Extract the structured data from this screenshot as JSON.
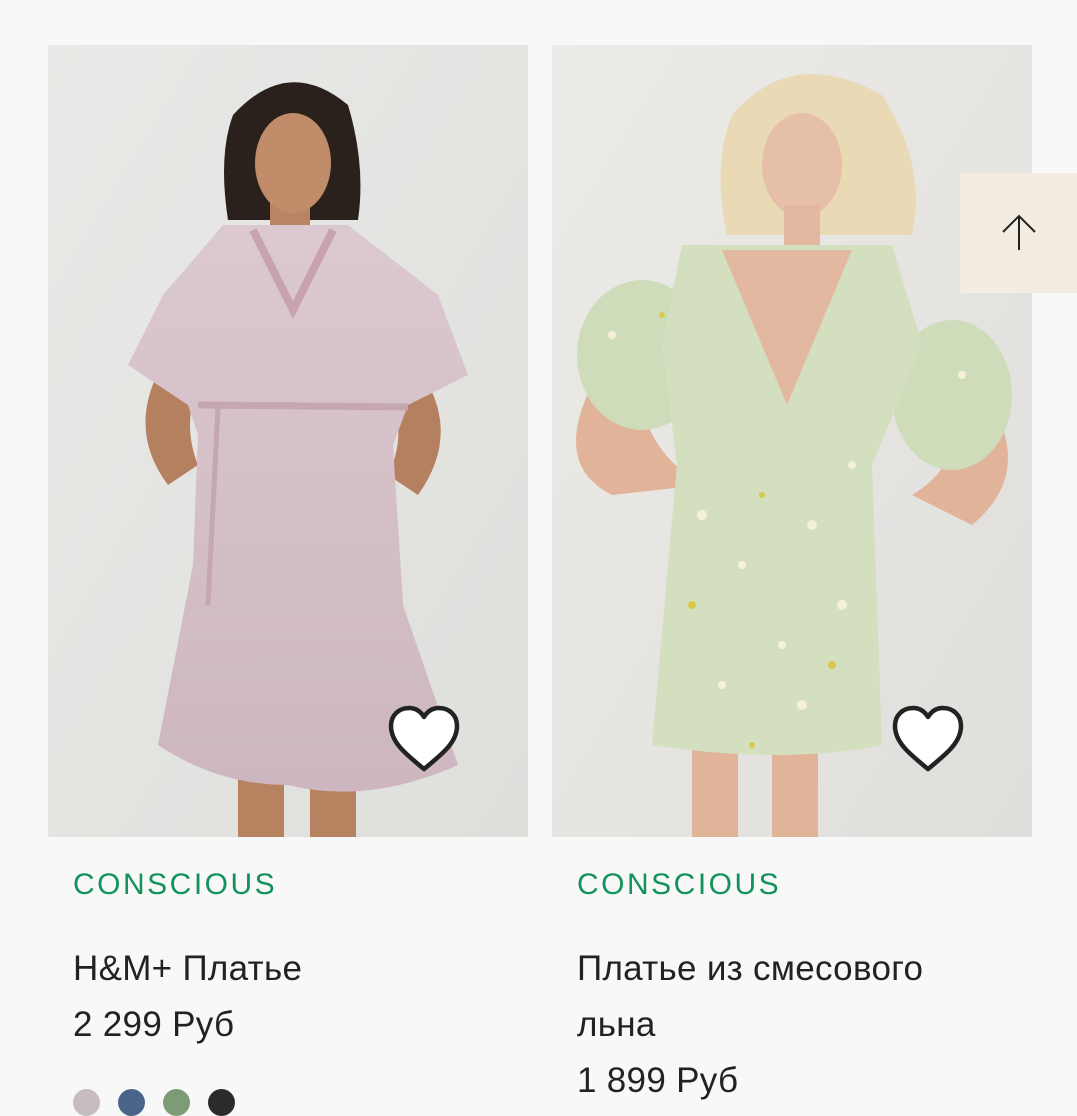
{
  "colors": {
    "page_background": "#f8f8f8",
    "conscious_green": "#13925b",
    "text": "#222222",
    "scroll_top_bg": "#f3ece0"
  },
  "products": [
    {
      "badge": "CONSCIOUS",
      "name": "H&M+ Платье",
      "price": "2 299 Руб",
      "image_desc": "model in lilac flutter-sleeve dress",
      "swatches": [
        "#c7bcc2",
        "#4a6589",
        "#7d9c76",
        "#2b2b2b"
      ]
    },
    {
      "badge": "CONSCIOUS",
      "name": "Платье из смесового льна",
      "price": "1 899 Руб",
      "image_desc": "model in mint floral puff-sleeve mini dress",
      "swatches": []
    }
  ],
  "icons": {
    "favorite": "heart-icon",
    "scroll_top": "arrow-up-icon"
  }
}
